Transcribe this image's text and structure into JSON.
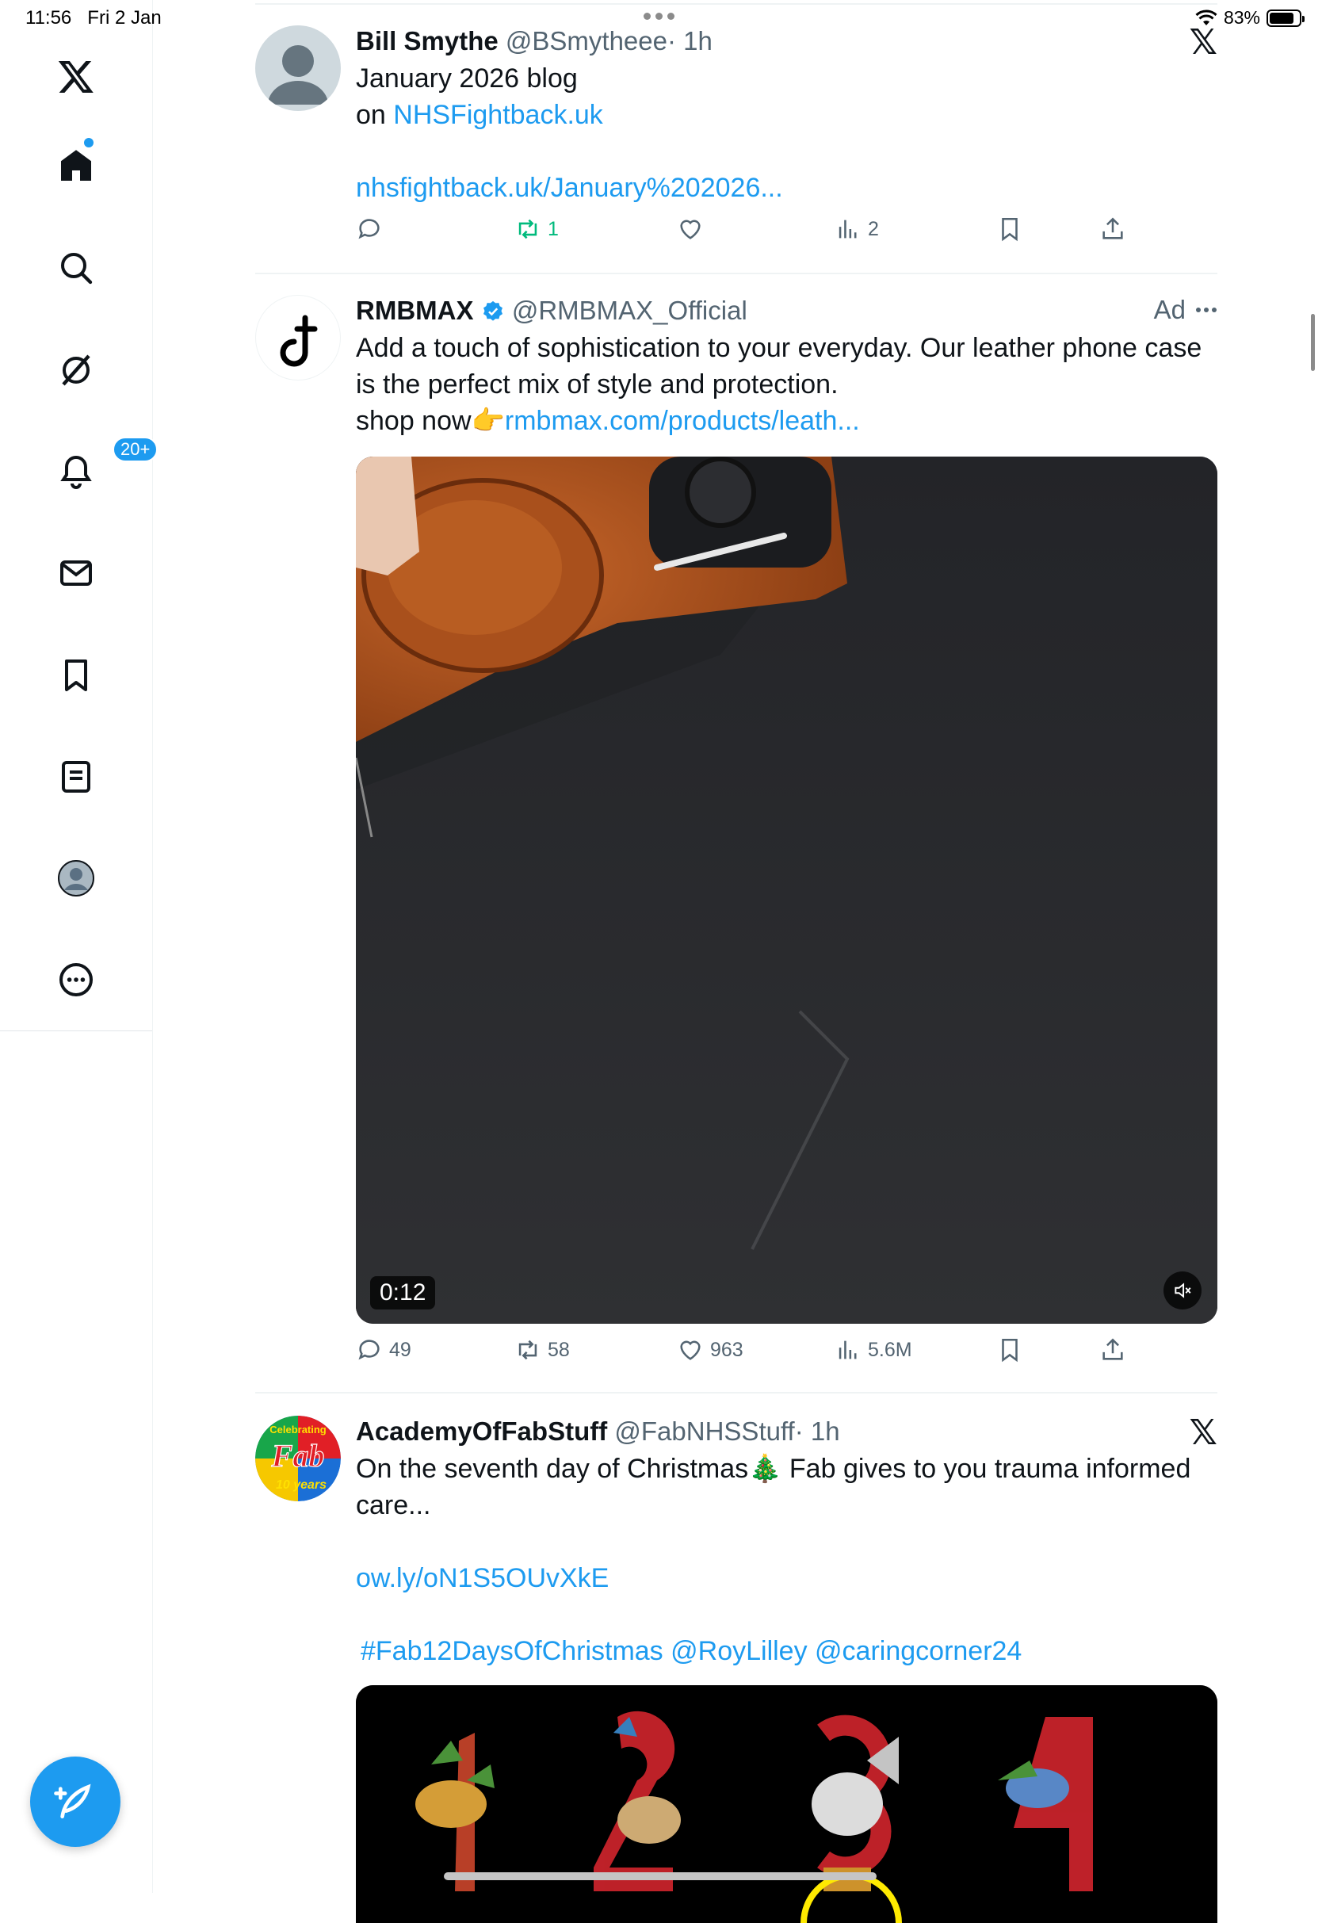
{
  "status_bar": {
    "time": "11:56",
    "date": "Fri 2 Jan",
    "battery": "83%"
  },
  "sidebar": {
    "notifications_badge": "20+",
    "items": [
      "x-logo",
      "home",
      "search",
      "grok",
      "notifications",
      "messages",
      "bookmarks",
      "lists",
      "profile",
      "more"
    ]
  },
  "tweets": [
    {
      "name": "Bill Smythe",
      "handle": "@BSmytheee",
      "time": "· 1h",
      "line1": "January 2026 blog",
      "line2_prefix": "on ",
      "line2_link": "NHSFightback.uk",
      "url": "nhsfightback.uk/January%202026...",
      "stats": {
        "reply": "",
        "retweet": "1",
        "like": "",
        "views": "2"
      }
    },
    {
      "name": "RMBMAX",
      "handle": "@RMBMAX_Official",
      "ad_label": "Ad",
      "line1": "Add a touch of sophistication to your everyday. Our leather phone case",
      "line2": "is the perfect mix of style and protection.",
      "line3_prefix": "shop now👉",
      "line3_link": "rmbmax.com/products/leath...",
      "video_time": "0:12",
      "stats": {
        "reply": "49",
        "retweet": "58",
        "like": "963",
        "views": "5.6M"
      }
    },
    {
      "name": "AcademyOfFabStuff",
      "handle": "@FabNHSStuff",
      "time": "· 1h",
      "line1": "On the seventh day of Christmas🎄 Fab gives to you trauma informed",
      "line2": "care...",
      "url": "ow.ly/oN1S5OUvXkE",
      "hashtags": "#Fab12DaysOfChristmas @RoyLilley @caringcorner24",
      "avatar_text_top": "Celebrating",
      "avatar_text_mid": "Fab",
      "avatar_text_bottom": "10 years"
    }
  ],
  "colors": {
    "accent": "#1d9bf0",
    "retweet_active": "#00ba7c",
    "muted": "#536471"
  }
}
